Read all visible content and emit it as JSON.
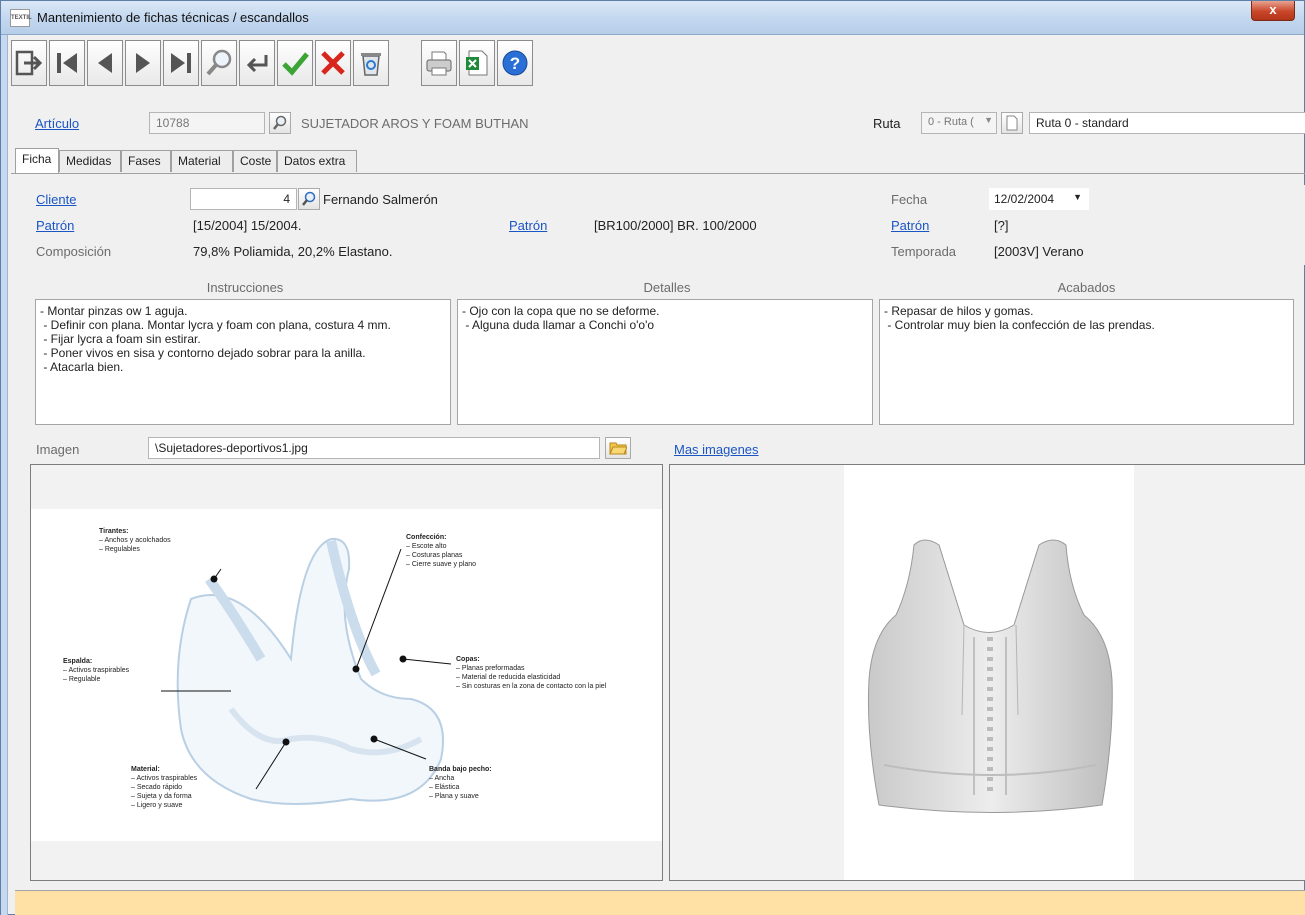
{
  "window": {
    "title": "Mantenimiento de fichas técnicas / escandallos",
    "app_icon_text": "TEXTIL",
    "close_label": "x"
  },
  "toolbar": {
    "buttons": [
      "exit-icon",
      "first-icon",
      "prev-icon",
      "next-icon",
      "last-icon",
      "search-icon",
      "return-icon",
      "accept-icon",
      "cancel-icon",
      "recycle-icon",
      "print-icon",
      "excel-icon",
      "help-icon"
    ]
  },
  "article": {
    "label": "Artículo",
    "code": "10788",
    "description": "SUJETADOR AROS Y FOAM BUTHAN",
    "route_label": "Ruta",
    "route_select": "0 - Ruta (",
    "route_name": "Ruta 0 - standard"
  },
  "tabs": [
    "Ficha",
    "Medidas",
    "Fases",
    "Material",
    "Coste",
    "Datos extra"
  ],
  "ficha": {
    "cliente_label": "Cliente",
    "cliente_code": "4",
    "cliente_name": "Fernando Salmerón",
    "fecha_label": "Fecha",
    "fecha_value": "12/02/2004",
    "patron1_label": "Patrón",
    "patron1_value": "[15/2004] 15/2004.",
    "patron2_label": "Patrón",
    "patron2_value": "[BR100/2000] BR. 100/2000",
    "patron3_label": "Patrón",
    "patron3_value": "[?]",
    "composicion_label": "Composición",
    "composicion_value": "79,8% Poliamida, 20,2% Elastano.",
    "temporada_label": "Temporada",
    "temporada_value": "[2003V] Verano"
  },
  "columns": {
    "instrucciones_label": "Instrucciones",
    "instrucciones_text": "- Montar pinzas ow 1 aguja.\n - Definir con plana. Montar lycra y foam con plana, costura 4 mm.\n - Fijar lycra a foam sin estirar.\n - Poner vivos en sisa y contorno dejado sobrar para la anilla.\n - Atacarla bien.",
    "detalles_label": "Detalles",
    "detalles_text": "- Ojo con la copa que no se deforme.\n - Alguna duda llamar a Conchi o'o'o",
    "acabados_label": "Acabados",
    "acabados_text": "- Repasar de hilos y gomas.\n - Controlar muy bien la confección de las prendas."
  },
  "imagen": {
    "label": "Imagen",
    "path": "\\Sujetadores-deportivos1.jpg",
    "more_link": "Mas imagenes"
  },
  "diagram": {
    "tirantes_title": "Tirantes:",
    "tirantes_1": "– Anchos y acolchados",
    "tirantes_2": "– Regulables",
    "confeccion_title": "Confección:",
    "confeccion_1": "– Escote alto",
    "confeccion_2": "– Costuras planas",
    "confeccion_3": "– Cierre suave y plano",
    "espalda_title": "Espalda:",
    "espalda_1": "– Activos traspirables",
    "espalda_2": "– Regulable",
    "copas_title": "Copas:",
    "copas_1": "– Planas preformadas",
    "copas_2": "– Material de reducida elasticidad",
    "copas_3": "– Sin costuras en la zona de contacto con la piel",
    "material_title": "Material:",
    "material_1": "– Activos traspirables",
    "material_2": "– Secado rápido",
    "material_3": "– Sujeta y da forma",
    "material_4": "– Ligero y suave",
    "banda_title": "Banda bajo pecho:",
    "banda_1": "– Ancha",
    "banda_2": "– Elástica",
    "banda_3": "– Plana y suave"
  },
  "colors": {
    "link": "#1a55c4",
    "status_bar": "#ffe1a6",
    "accept": "#3aa534",
    "cancel": "#d9261c"
  }
}
